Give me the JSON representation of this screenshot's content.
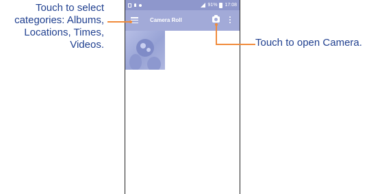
{
  "callouts": {
    "left": {
      "line1": "Touch to select",
      "line2": "categories: Albums,",
      "line3": "Locations, Times,",
      "line4": "Videos."
    },
    "right": "Touch to open Camera."
  },
  "statusbar": {
    "battery": "91%",
    "time": "17:08"
  },
  "appbar": {
    "title": "Camera Roll",
    "menu_icon": "hamburger-menu-icon",
    "camera_icon": "camera-icon",
    "overflow_icon": "more-vert-icon"
  },
  "colors": {
    "callout_text": "#1f3f8f",
    "connector": "#f08a3a",
    "appbar": "#a2aad8",
    "statusbar": "#8e97cc"
  },
  "gallery": {
    "items": [
      {
        "type": "photo"
      }
    ]
  }
}
